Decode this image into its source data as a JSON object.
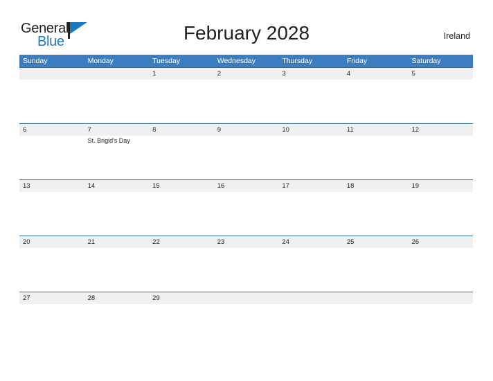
{
  "brand": {
    "name_part1": "General",
    "name_part2": "Blue",
    "flag_icon": "flag-triangle-icon",
    "accent_color": "#1879bf"
  },
  "header": {
    "title": "February 2028",
    "country": "Ireland"
  },
  "theme": {
    "header_blue": "#3b7dbf",
    "row_border_blue": "#2a6ca8",
    "band_gray": "#f0f0f0",
    "text_dark": "#231f20",
    "page_background": "#ffffff"
  },
  "calendar": {
    "month": "February",
    "year": "2028",
    "weekday_headers": [
      "Sunday",
      "Monday",
      "Tuesday",
      "Wednesday",
      "Thursday",
      "Friday",
      "Saturday"
    ],
    "weeks": [
      {
        "days": [
          {
            "number": "",
            "event": ""
          },
          {
            "number": "",
            "event": ""
          },
          {
            "number": "1",
            "event": ""
          },
          {
            "number": "2",
            "event": ""
          },
          {
            "number": "3",
            "event": ""
          },
          {
            "number": "4",
            "event": ""
          },
          {
            "number": "5",
            "event": ""
          }
        ]
      },
      {
        "days": [
          {
            "number": "6",
            "event": ""
          },
          {
            "number": "7",
            "event": "St. Brigid's Day"
          },
          {
            "number": "8",
            "event": ""
          },
          {
            "number": "9",
            "event": ""
          },
          {
            "number": "10",
            "event": ""
          },
          {
            "number": "11",
            "event": ""
          },
          {
            "number": "12",
            "event": ""
          }
        ]
      },
      {
        "days": [
          {
            "number": "13",
            "event": ""
          },
          {
            "number": "14",
            "event": ""
          },
          {
            "number": "15",
            "event": ""
          },
          {
            "number": "16",
            "event": ""
          },
          {
            "number": "17",
            "event": ""
          },
          {
            "number": "18",
            "event": ""
          },
          {
            "number": "19",
            "event": ""
          }
        ]
      },
      {
        "days": [
          {
            "number": "20",
            "event": ""
          },
          {
            "number": "21",
            "event": ""
          },
          {
            "number": "22",
            "event": ""
          },
          {
            "number": "23",
            "event": ""
          },
          {
            "number": "24",
            "event": ""
          },
          {
            "number": "25",
            "event": ""
          },
          {
            "number": "26",
            "event": ""
          }
        ]
      },
      {
        "days": [
          {
            "number": "27",
            "event": ""
          },
          {
            "number": "28",
            "event": ""
          },
          {
            "number": "29",
            "event": ""
          },
          {
            "number": "",
            "event": ""
          },
          {
            "number": "",
            "event": ""
          },
          {
            "number": "",
            "event": ""
          },
          {
            "number": "",
            "event": ""
          }
        ]
      }
    ]
  }
}
